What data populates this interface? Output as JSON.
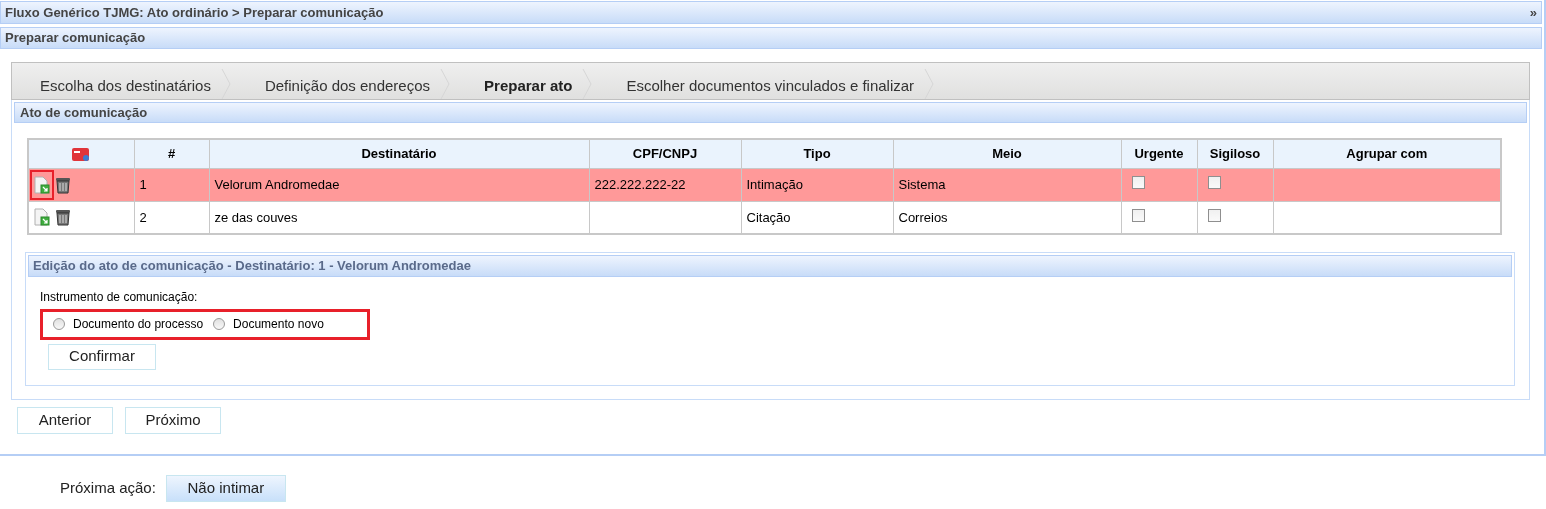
{
  "header": {
    "title": "Fluxo Genérico TJMG: Ato ordinário > Preparar comunicação",
    "toggle": "»"
  },
  "subheader": {
    "title": "Preparar comunicação"
  },
  "tabs": [
    {
      "label": "Escolha dos destinatários",
      "selected": false
    },
    {
      "label": "Definição dos endereços",
      "selected": false
    },
    {
      "label": "Preparar ato",
      "selected": true
    },
    {
      "label": "Escolher documentos vinculados e finalizar",
      "selected": false
    }
  ],
  "section": {
    "title": "Ato de comunicação"
  },
  "table": {
    "columns": [
      "#",
      "Destinatário",
      "CPF/CNPJ",
      "Tipo",
      "Meio",
      "Urgente",
      "Sigiloso",
      "Agrupar com"
    ],
    "rows": [
      {
        "selected": true,
        "number": "1",
        "recipient": "Velorum Andromedae",
        "cpf_cnpj": "222.222.222-22",
        "type": "Intimação",
        "channel": "Sistema",
        "urgent": false,
        "confidential": false
      },
      {
        "selected": false,
        "number": "2",
        "recipient": "ze das couves",
        "type": "Citação",
        "channel": "Correios",
        "urgent": false,
        "confidential": false
      }
    ]
  },
  "edit": {
    "title": "Edição do ato de comunicação - Destinatário: 1 - Velorum Andromedae",
    "label": "Instrumento de comunicação:",
    "options": [
      {
        "label": "Documento do processo",
        "selected": false
      },
      {
        "label": "Documento novo",
        "selected": false
      }
    ],
    "confirm": "Confirmar"
  },
  "nav": [
    "Anterior",
    "Próximo"
  ],
  "next_action": {
    "label": "Próxima ação:",
    "button": "Não intimar"
  }
}
